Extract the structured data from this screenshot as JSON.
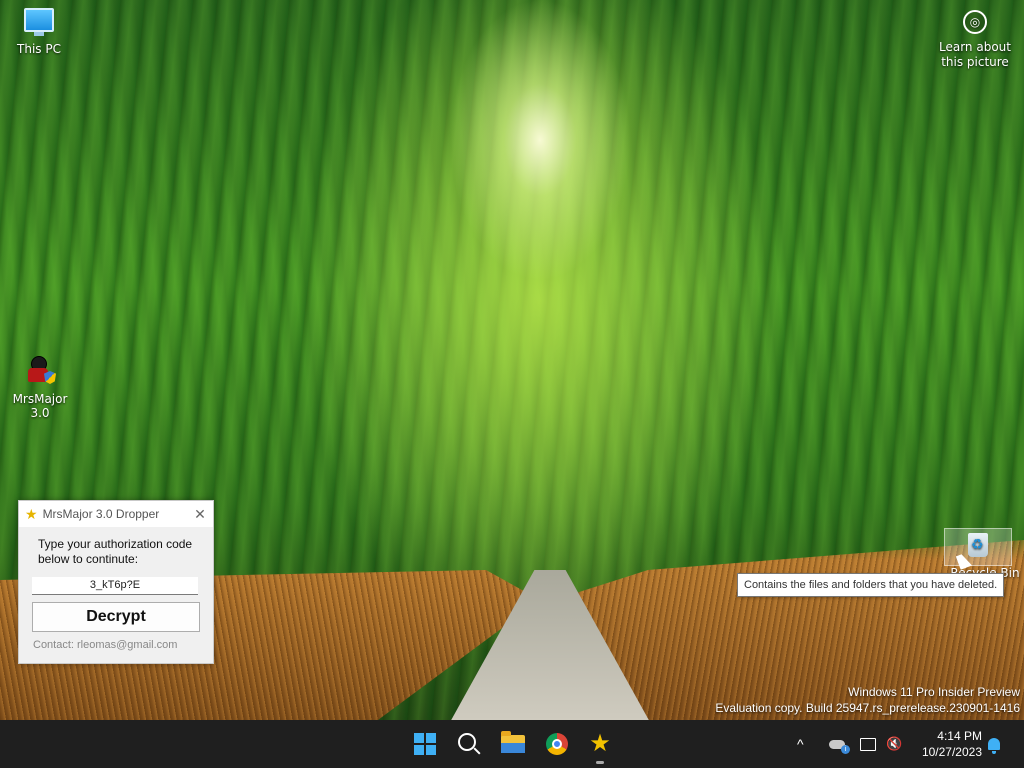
{
  "desktop": {
    "icons": {
      "this_pc": "This PC",
      "mrsmajor": "MrsMajor 3.0",
      "learn_about": "Learn about this picture",
      "recycle_bin": "Recycle Bin"
    },
    "tooltip": "Contains the files and folders that you have deleted.",
    "watermark": {
      "line1": "Windows 11 Pro Insider Preview",
      "line2": "Evaluation copy. Build 25947.rs_prerelease.230901-1416"
    }
  },
  "dialog": {
    "title": "MrsMajor 3.0 Dropper",
    "close_glyph": "✕",
    "prompt": "Type your authorization code below to continute:",
    "code_value": "3_kT6p?E",
    "decrypt_label": "Decrypt",
    "contact": "Contact: rleomas@gmail.com"
  },
  "taskbar": {
    "apps": [
      "start-icon",
      "search-icon",
      "file-explorer-icon",
      "chrome-icon",
      "mrsmajor-icon"
    ],
    "tray": {
      "chevron": "^",
      "volume_glyph": "🔇"
    },
    "clock": {
      "time": "4:14 PM",
      "date": "10/27/2023"
    }
  },
  "colors": {
    "taskbar": "#1f1f1f",
    "accent": "#3fb0f5",
    "dialog_bg": "#f0f0f0"
  }
}
